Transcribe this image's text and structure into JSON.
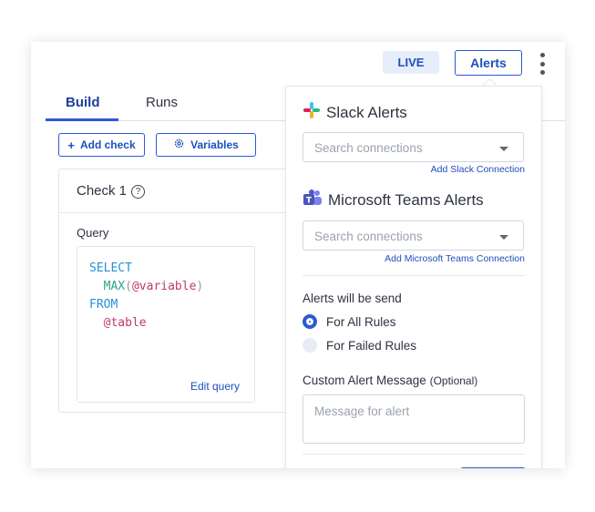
{
  "header": {
    "live_badge": "LIVE",
    "alerts_button": "Alerts"
  },
  "tabs": [
    {
      "label": "Build",
      "active": true
    },
    {
      "label": "Runs",
      "active": false
    }
  ],
  "toolbar": {
    "add_check": "Add check",
    "variables": "Variables"
  },
  "check": {
    "title": "Check 1",
    "help_glyph": "?",
    "query_label": "Query",
    "code": {
      "select": "SELECT",
      "fn": "MAX",
      "open": "(",
      "var1": "@variable",
      "close": ")",
      "from": "FROM",
      "var2": "@table"
    },
    "edit_query": "Edit query"
  },
  "alerts_panel": {
    "slack": {
      "title": "Slack Alerts",
      "placeholder": "Search connections",
      "add_link": "Add Slack Connection"
    },
    "teams": {
      "title": "Microsoft Teams Alerts",
      "placeholder": "Search connections",
      "add_link": "Add Microsoft Teams Connection"
    },
    "send_label": "Alerts will be send",
    "options": [
      {
        "label": "For All Rules",
        "selected": true
      },
      {
        "label": "For Failed Rules",
        "selected": false
      }
    ],
    "custom_message": {
      "label": "Custom Alert Message",
      "optional": "(Optional)",
      "placeholder": "Message for alert"
    }
  },
  "colors": {
    "accent": "#2b5ad4",
    "live_bg": "#e7eefb",
    "slack": [
      "#36c5f0",
      "#2eb67d",
      "#ecb22e",
      "#e01e5a"
    ],
    "teams": "#5059c9"
  }
}
